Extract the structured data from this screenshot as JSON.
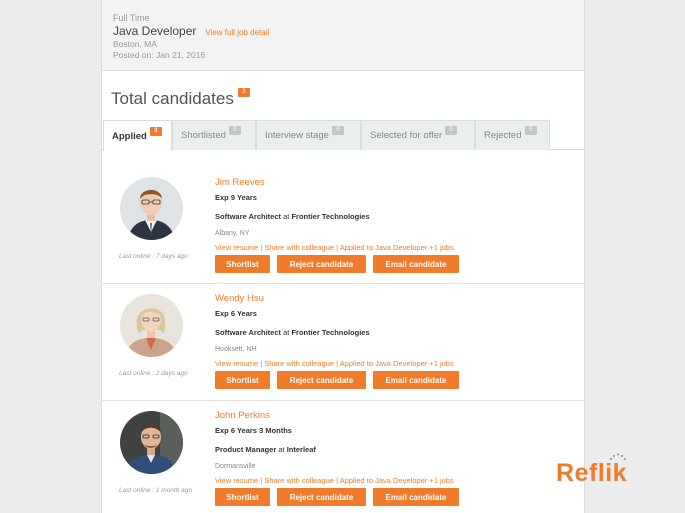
{
  "job": {
    "type": "Full Time",
    "title": "Java Developer",
    "view_link": "View full job detail",
    "location": "Boston, MA",
    "posted": "Posted on: Jan 21, 2016"
  },
  "total": {
    "label": "Total candidates",
    "count": "3"
  },
  "tabs": [
    {
      "label": "Applied",
      "count": "3"
    },
    {
      "label": "Shortlisted",
      "count": "0"
    },
    {
      "label": "Interview stage",
      "count": "0"
    },
    {
      "label": "Selected for offer",
      "count": "0"
    },
    {
      "label": "Rejected",
      "count": "0"
    }
  ],
  "candidates": [
    {
      "name": "Jim Reeves",
      "exp": "Exp 9 Years",
      "title": "Software Architect",
      "at": " at ",
      "company": "Frontier Technologies",
      "city": "Albany, NY",
      "last_online": "Last online : 7 days ago"
    },
    {
      "name": "Wendy Hsu",
      "exp": "Exp 6 Years",
      "title": "Software Architect",
      "at": " at ",
      "company": "Frontier Technologies",
      "city": "Hooksett, NH",
      "last_online": "Last online : 2 days ago"
    },
    {
      "name": "John Perkins",
      "exp": "Exp 6 Years 3 Months",
      "title": "Product Manager",
      "at": " at ",
      "company": "Interleaf",
      "city": "Dormansville",
      "last_online": "Last online : 1 month ago"
    }
  ],
  "links": {
    "resume": "View resume",
    "sep": " | ",
    "share": "Share with colleague",
    "applied": "Applied to Java Developer +1 jobs"
  },
  "buttons": {
    "shortlist": "Shortlist",
    "reject": "Reject candidate",
    "email": "Email candidate"
  },
  "brand": {
    "name": "Reflik",
    "color": "#f07b2a"
  }
}
